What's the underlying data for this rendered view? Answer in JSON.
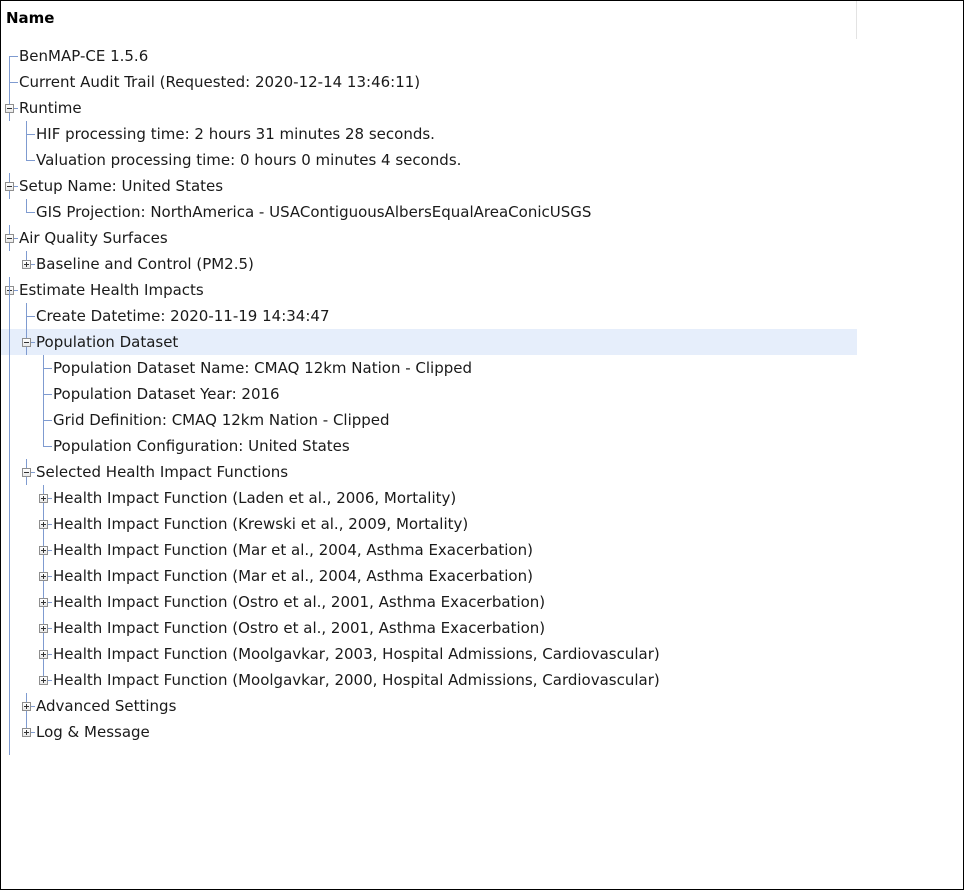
{
  "header": {
    "name": "Name"
  },
  "colors": {
    "line": "#7f9bd0",
    "selection": "#e6eefb"
  },
  "tree": [
    {
      "label": "BenMAP-CE 1.5.6",
      "depth": 0,
      "state": "leaf"
    },
    {
      "label": "Current Audit Trail (Requested: 2020-12-14 13:46:11)",
      "depth": 0,
      "state": "leaf"
    },
    {
      "label": "Runtime",
      "depth": 0,
      "state": "expanded"
    },
    {
      "label": "HIF processing time: 2 hours 31 minutes 28 seconds.",
      "depth": 1,
      "state": "leaf"
    },
    {
      "label": "Valuation processing time: 0 hours 0 minutes 4 seconds.",
      "depth": 1,
      "state": "leaf"
    },
    {
      "label": "Setup Name: United States",
      "depth": 0,
      "state": "expanded"
    },
    {
      "label": "GIS Projection: NorthAmerica - USAContiguousAlbersEqualAreaConicUSGS",
      "depth": 1,
      "state": "leaf"
    },
    {
      "label": "Air Quality Surfaces",
      "depth": 0,
      "state": "expanded"
    },
    {
      "label": "Baseline and Control (PM2.5)",
      "depth": 1,
      "state": "collapsed"
    },
    {
      "label": "Estimate Health Impacts",
      "depth": 0,
      "state": "expanded"
    },
    {
      "label": "Create Datetime: 2020-11-19 14:34:47",
      "depth": 1,
      "state": "leaf"
    },
    {
      "label": "Population Dataset",
      "depth": 1,
      "state": "expanded",
      "selected": true
    },
    {
      "label": "Population Dataset Name: CMAQ 12km Nation - Clipped",
      "depth": 2,
      "state": "leaf"
    },
    {
      "label": "Population Dataset Year: 2016",
      "depth": 2,
      "state": "leaf"
    },
    {
      "label": "Grid Definition: CMAQ 12km Nation - Clipped",
      "depth": 2,
      "state": "leaf"
    },
    {
      "label": "Population Configuration: United States",
      "depth": 2,
      "state": "leaf"
    },
    {
      "label": "Selected Health Impact Functions",
      "depth": 1,
      "state": "expanded"
    },
    {
      "label": "Health Impact Function (Laden et al., 2006, Mortality)",
      "depth": 2,
      "state": "collapsed"
    },
    {
      "label": "Health Impact Function (Krewski et al., 2009, Mortality)",
      "depth": 2,
      "state": "collapsed"
    },
    {
      "label": "Health Impact Function (Mar et al., 2004, Asthma Exacerbation)",
      "depth": 2,
      "state": "collapsed"
    },
    {
      "label": "Health Impact Function (Mar et al., 2004, Asthma Exacerbation)",
      "depth": 2,
      "state": "collapsed"
    },
    {
      "label": "Health Impact Function (Ostro et al., 2001, Asthma Exacerbation)",
      "depth": 2,
      "state": "collapsed"
    },
    {
      "label": "Health Impact Function (Ostro et al., 2001, Asthma Exacerbation)",
      "depth": 2,
      "state": "collapsed"
    },
    {
      "label": "Health Impact Function (Moolgavkar, 2003, Hospital Admissions, Cardiovascular)",
      "depth": 2,
      "state": "collapsed"
    },
    {
      "label": "Health Impact Function (Moolgavkar, 2000, Hospital Admissions, Cardiovascular)",
      "depth": 2,
      "state": "collapsed"
    },
    {
      "label": "Advanced Settings",
      "depth": 1,
      "state": "collapsed"
    },
    {
      "label": "Log & Message",
      "depth": 1,
      "state": "collapsed"
    }
  ]
}
